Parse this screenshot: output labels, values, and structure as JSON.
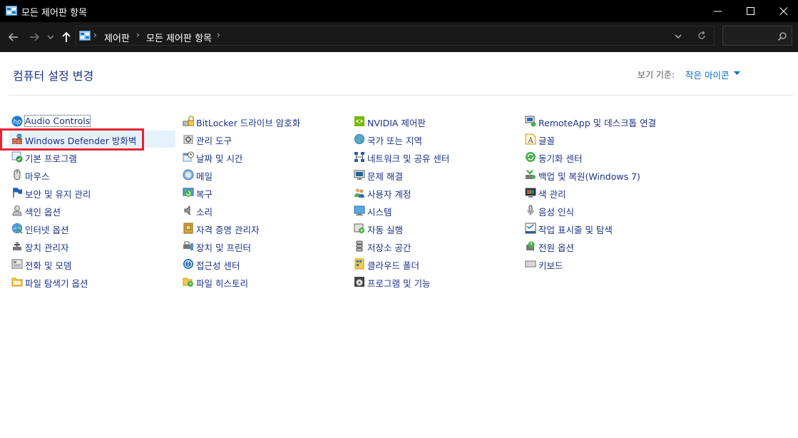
{
  "window": {
    "title": "모든 제어판 항목",
    "controls": [
      "minimize",
      "maximize",
      "close"
    ]
  },
  "address_bar": {
    "breadcrumbs": [
      "제어판",
      "모든 제어판 항목"
    ],
    "search_placeholder": ""
  },
  "header": {
    "title": "컴퓨터 설정 변경",
    "view_by_label": "보기 기준:",
    "view_by_value": "작은 아이콘"
  },
  "columns": [
    [
      {
        "label": "Audio Controls",
        "icon": "hp-icon"
      },
      {
        "label": "Windows Defender 방화벽",
        "icon": "firewall-icon"
      },
      {
        "label": "기본 프로그램",
        "icon": "default-programs-icon"
      },
      {
        "label": "마우스",
        "icon": "mouse-icon"
      },
      {
        "label": "보안 및 유지 관리",
        "icon": "flag-icon"
      },
      {
        "label": "색인 옵션",
        "icon": "indexing-icon"
      },
      {
        "label": "인터넷 옵션",
        "icon": "internet-options-icon"
      },
      {
        "label": "장치 관리자",
        "icon": "device-manager-icon"
      },
      {
        "label": "전화 및 모뎀",
        "icon": "phone-modem-icon"
      },
      {
        "label": "파일 탐색기 옵션",
        "icon": "folder-options-icon"
      }
    ],
    [
      {
        "label": "BitLocker 드라이브 암호화",
        "icon": "bitlocker-icon"
      },
      {
        "label": "관리 도구",
        "icon": "admin-tools-icon"
      },
      {
        "label": "날짜 및 시간",
        "icon": "date-time-icon"
      },
      {
        "label": "메일",
        "icon": "mail-icon"
      },
      {
        "label": "복구",
        "icon": "recovery-icon"
      },
      {
        "label": "소리",
        "icon": "sound-icon"
      },
      {
        "label": "자격 증명 관리자",
        "icon": "credential-icon"
      },
      {
        "label": "장치 및 프린터",
        "icon": "printer-icon"
      },
      {
        "label": "접근성 센터",
        "icon": "accessibility-icon"
      },
      {
        "label": "파일 히스토리",
        "icon": "file-history-icon"
      }
    ],
    [
      {
        "label": "NVIDIA 제어판",
        "icon": "nvidia-icon"
      },
      {
        "label": "국가 또는 지역",
        "icon": "region-icon"
      },
      {
        "label": "네트워크 및 공유 센터",
        "icon": "network-icon"
      },
      {
        "label": "문제 해결",
        "icon": "troubleshoot-icon"
      },
      {
        "label": "사용자 계정",
        "icon": "user-accounts-icon"
      },
      {
        "label": "시스템",
        "icon": "system-icon"
      },
      {
        "label": "자동 실행",
        "icon": "autoplay-icon"
      },
      {
        "label": "저장소 공간",
        "icon": "storage-icon"
      },
      {
        "label": "클라우드 폴더",
        "icon": "work-folders-icon"
      },
      {
        "label": "프로그램 및 기능",
        "icon": "programs-icon"
      }
    ],
    [
      {
        "label": "RemoteApp 및 데스크톱 연결",
        "icon": "remoteapp-icon"
      },
      {
        "label": "글꼴",
        "icon": "fonts-icon"
      },
      {
        "label": "동기화 센터",
        "icon": "sync-icon"
      },
      {
        "label": "백업 및 복원(Windows 7)",
        "icon": "backup-icon"
      },
      {
        "label": "색 관리",
        "icon": "color-management-icon"
      },
      {
        "label": "음성 인식",
        "icon": "microphone-icon"
      },
      {
        "label": "작업 표시줄 및 탐색",
        "icon": "taskbar-icon"
      },
      {
        "label": "전원 옵션",
        "icon": "power-icon"
      },
      {
        "label": "키보드",
        "icon": "keyboard-icon"
      }
    ]
  ],
  "colors": {
    "title_bar": "#000000",
    "address_bar": "#191919",
    "link": "#1e3287",
    "accent": "#0066cc",
    "hover": "#e5f1fb",
    "annotation": "#e52532"
  }
}
